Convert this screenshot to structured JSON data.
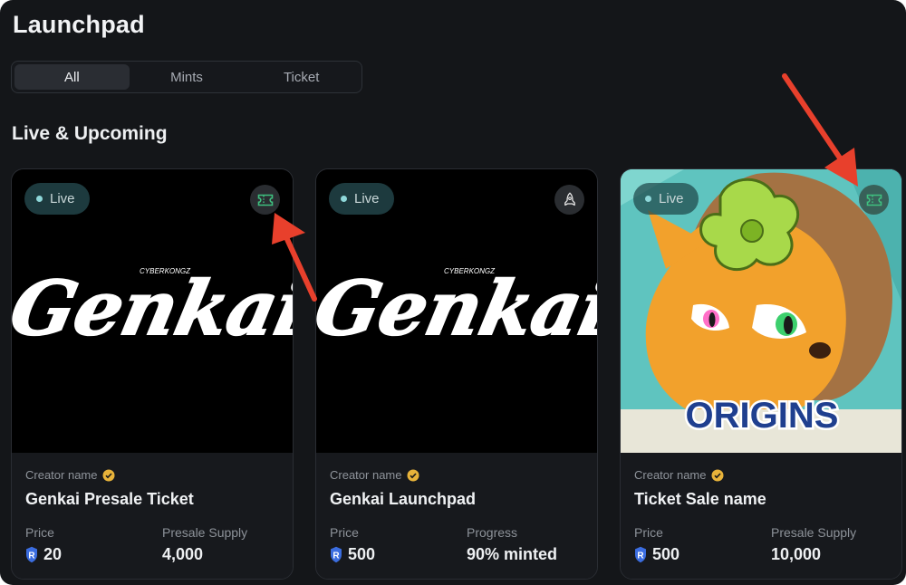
{
  "page": {
    "title": "Launchpad"
  },
  "tabs": [
    {
      "label": "All",
      "active": true
    },
    {
      "label": "Mints",
      "active": false
    },
    {
      "label": "Ticket",
      "active": false
    }
  ],
  "section": {
    "title": "Live & Upcoming"
  },
  "cards": [
    {
      "status": "Live",
      "type_icon": "ticket-icon",
      "image_text": "Genkai",
      "image_subtext": "CYBERKONGZ",
      "creator": "Creator name",
      "name": "Genkai Presale Ticket",
      "stat1_label": "Price",
      "stat1_value": "20",
      "stat2_label": "Presale Supply",
      "stat2_value": "4,000"
    },
    {
      "status": "Live",
      "type_icon": "rocket-icon",
      "image_text": "Genkai",
      "image_subtext": "CYBERKONGZ",
      "creator": "Creator name",
      "name": "Genkai Launchpad",
      "stat1_label": "Price",
      "stat1_value": "500",
      "stat2_label": "Progress",
      "stat2_value": "90% minted"
    },
    {
      "status": "Live",
      "type_icon": "ticket-icon",
      "image_text": "ORIGINS",
      "creator": "Creator name",
      "name": "Ticket Sale name",
      "stat1_label": "Price",
      "stat1_value": "500",
      "stat2_label": "Presale Supply",
      "stat2_value": "10,000"
    }
  ],
  "colors": {
    "background": "#141619",
    "card": "#17191d",
    "live_badge": "#1d3a3e",
    "ticket_icon": "#3fbf7f",
    "verified": "#e8b33a",
    "token": "#3b6de0",
    "annotation_arrow": "#e8402c"
  }
}
